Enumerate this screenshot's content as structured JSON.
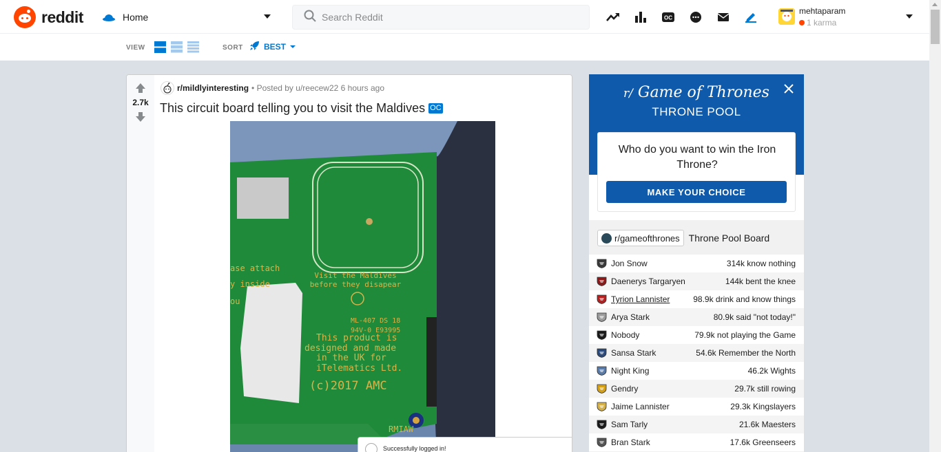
{
  "header": {
    "brand": "reddit",
    "feed_selector": "Home",
    "search_placeholder": "Search Reddit",
    "user": {
      "name": "mehtaparam",
      "karma": "1 karma"
    }
  },
  "subheader": {
    "view_label": "VIEW",
    "sort_label": "SORT",
    "sort_value": "BEST"
  },
  "post": {
    "votes": "2.7k",
    "subreddit": "r/mildlyinteresting",
    "meta": "• Posted by u/reecew22 6 hours ago",
    "title": "This circuit board telling you to visit the Maldives",
    "flair": "OC",
    "image_text": {
      "line1": "Visit the Maldives",
      "line2": "before they disapear",
      "partial1": "ase attach",
      "partial2": "y inside",
      "partial3": "ou",
      "ml": "ML-407 DS 18",
      "ul": "94V-0 E93995",
      "product": [
        "This product is",
        "designed and made",
        "in the UK for",
        "iTelematics Ltd."
      ],
      "copyright": "(c)2017  AMC",
      "rmiaw": "RMIAW"
    }
  },
  "toast": {
    "message": "Successfully logged in!"
  },
  "widget": {
    "title_prefix": "r/",
    "title": "Game of Thrones",
    "subtitle": "THRONE POOL",
    "question": "Who do you want to win the Iron Throne?",
    "cta": "MAKE YOUR CHOICE",
    "board_subreddit": "r/gameofthrones",
    "board_title": "Throne Pool Board",
    "rows": [
      {
        "name": "Jon Snow",
        "stat": "314k know nothing",
        "color": "#3a3a3a"
      },
      {
        "name": "Daenerys Targaryen",
        "stat": "144k bent the knee",
        "color": "#8b1a1a"
      },
      {
        "name": "Tyrion Lannister",
        "stat": "98.9k drink and know things",
        "color": "#b22222"
      },
      {
        "name": "Arya Stark",
        "stat": "80.9k said \"not today!\"",
        "color": "#9a9a9a"
      },
      {
        "name": "Nobody",
        "stat": "79.9k not playing the Game",
        "color": "#1a1a1a"
      },
      {
        "name": "Sansa Stark",
        "stat": "54.6k Remember the North",
        "color": "#2c4a7a"
      },
      {
        "name": "Night King",
        "stat": "46.2k Wights",
        "color": "#5a7aa8"
      },
      {
        "name": "Gendry",
        "stat": "29.7k still rowing",
        "color": "#d4a017"
      },
      {
        "name": "Jaime Lannister",
        "stat": "29.3k Kingslayers",
        "color": "#d4b04a"
      },
      {
        "name": "Sam Tarly",
        "stat": "21.6k Maesters",
        "color": "#1a1a1a"
      },
      {
        "name": "Bran Stark",
        "stat": "17.6k Greenseers",
        "color": "#555555"
      }
    ]
  }
}
